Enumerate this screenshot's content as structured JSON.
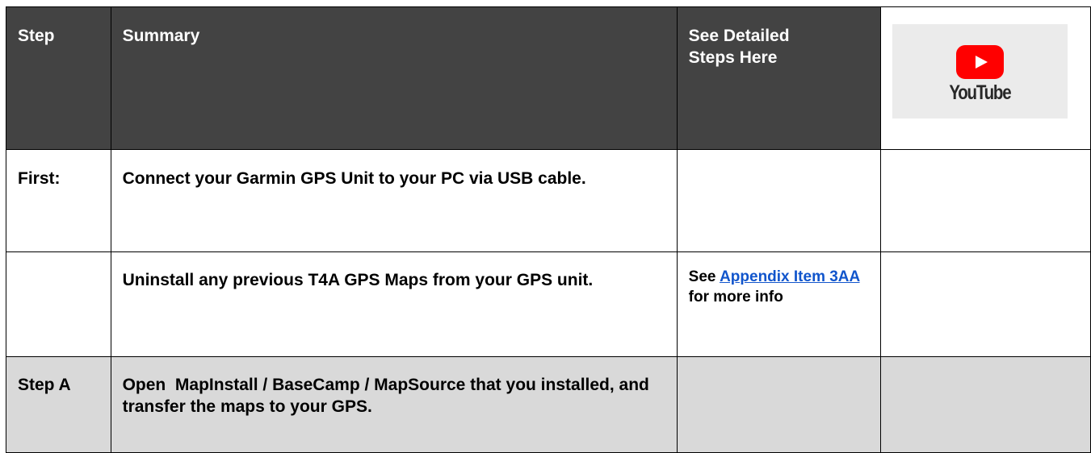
{
  "header": {
    "step": "Step",
    "summary": "Summary",
    "detailed_line1": "See Detailed",
    "detailed_line2": "Steps Here",
    "youtube_logo_text": "YouTube"
  },
  "colors": {
    "header_bg": "#434343",
    "highlight_row_bg": "#d9d9d9",
    "link": "#1155cc",
    "youtube_red": "#ff0000"
  },
  "rows": [
    {
      "step": "First:",
      "summary": "Connect your Garmin GPS Unit to your PC via USB cable.",
      "detail_prefix": "",
      "detail_link": "",
      "detail_suffix": ""
    },
    {
      "step": "",
      "summary": "Uninstall any previous T4A GPS Maps from your GPS unit.",
      "detail_prefix": "See ",
      "detail_link": "Appendix Item 3AA",
      "detail_suffix": " for more info"
    },
    {
      "step": "Step A",
      "summary": "Open  MapInstall / BaseCamp / MapSource that you installed, and transfer the maps to your GPS.",
      "detail_prefix": "",
      "detail_link": "",
      "detail_suffix": ""
    }
  ]
}
